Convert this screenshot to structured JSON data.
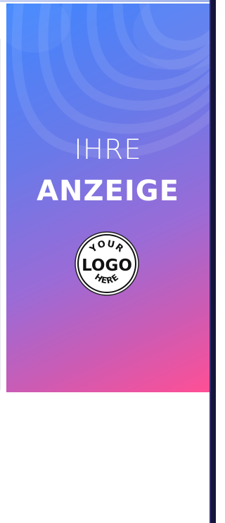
{
  "ad": {
    "title_light": "IHRE",
    "title_bold": "ANZEIGE",
    "logo": {
      "line1": "YOUR",
      "line2": "LOGO",
      "line3": "HERE"
    },
    "gradient_colors": [
      "#3f86ff",
      "#9b6bd6",
      "#ff4f95"
    ]
  },
  "chrome": {
    "right_bar_color": "#15143a",
    "top_accent_color": "#9aaee8"
  }
}
